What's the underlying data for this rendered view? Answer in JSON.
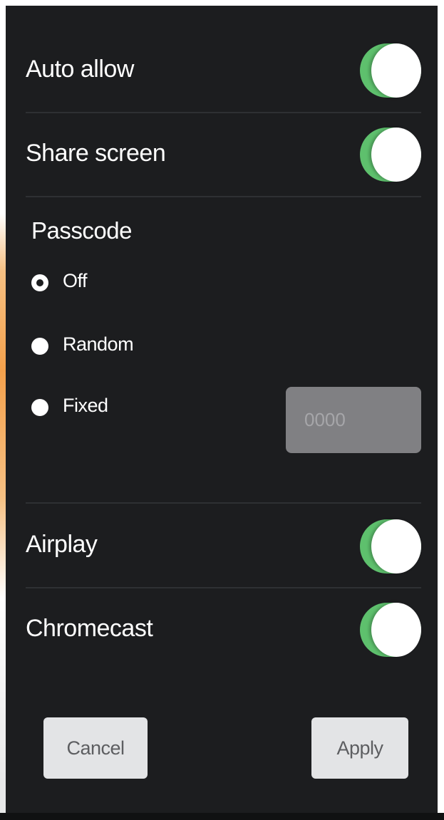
{
  "settings": {
    "auto_allow": {
      "label": "Auto allow",
      "enabled": true
    },
    "share_screen": {
      "label": "Share screen",
      "enabled": true
    },
    "airplay": {
      "label": "Airplay",
      "enabled": true
    },
    "chromecast": {
      "label": "Chromecast",
      "enabled": true
    }
  },
  "passcode": {
    "title": "Passcode",
    "options": [
      {
        "label": "Off",
        "selected": true
      },
      {
        "label": "Random",
        "selected": false
      },
      {
        "label": "Fixed",
        "selected": false
      }
    ],
    "fixed_placeholder": "0000"
  },
  "actions": {
    "cancel_label": "Cancel",
    "apply_label": "Apply"
  },
  "colors": {
    "panel_background": "#1c1d1f",
    "toggle_on": "#5ec06d",
    "input_background": "#808083",
    "button_background": "#e3e4e6"
  }
}
